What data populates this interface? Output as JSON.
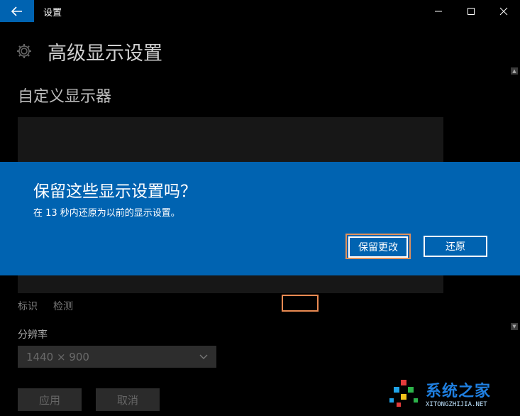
{
  "window": {
    "app_title": "设置",
    "back_icon": "arrow-left-icon",
    "controls": [
      "minimize-icon",
      "maximize-icon",
      "close-icon"
    ]
  },
  "page": {
    "icon": "gear-icon",
    "title": "高级显示设置",
    "section_title": "自定义显示器"
  },
  "display_links": {
    "identify": "标识",
    "detect": "检测"
  },
  "resolution": {
    "label": "分辨率",
    "value": "1440 × 900"
  },
  "actions": {
    "apply": "应用",
    "cancel": "取消"
  },
  "dialog": {
    "title": "保留这些显示设置吗？",
    "message": "在 13 秒内还原为以前的显示设置。",
    "keep_button": "保留更改",
    "revert_button": "还原",
    "background": "#0063b1"
  },
  "watermark": {
    "text": "系统之家",
    "url": "XITONGZHIJIA.NET"
  },
  "colors": {
    "accent": "#0063b1",
    "highlight": "#e98a52"
  }
}
